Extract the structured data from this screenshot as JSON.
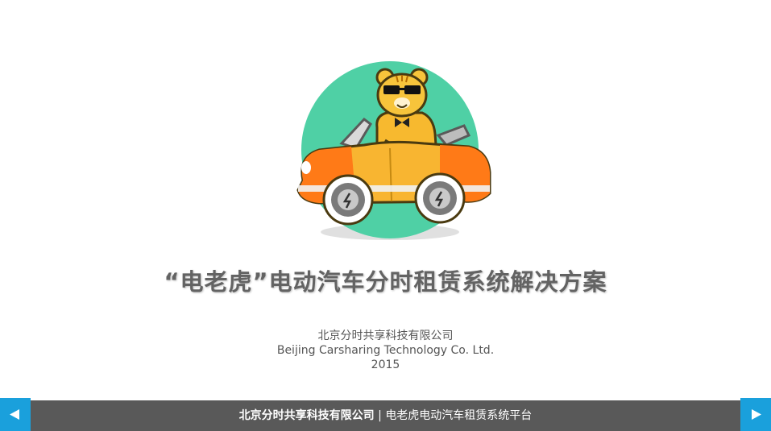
{
  "slide": {
    "title": "“电老虎”电动汽车分时租赁系统解决方案",
    "company_cn": "北京分时共享科技有限公司",
    "company_en": "Beijing Carsharing Technology Co. Ltd.",
    "year": "2015"
  },
  "footer": {
    "company": "北京分时共享科技有限公司",
    "separator": " | ",
    "platform": "电老虎电动汽车租赁系统平台"
  },
  "navigation": {
    "prev_icon": "triangle-left-icon",
    "next_icon": "triangle-right-icon"
  },
  "colors": {
    "logo_circle": "#4fd0a5",
    "car_orange": "#ff7a17",
    "car_yellow": "#f8b531",
    "tiger_yellow": "#f7c43b",
    "footer_bg": "#595959",
    "nav_blue": "#1aa0dc",
    "title_gray": "#636363"
  }
}
